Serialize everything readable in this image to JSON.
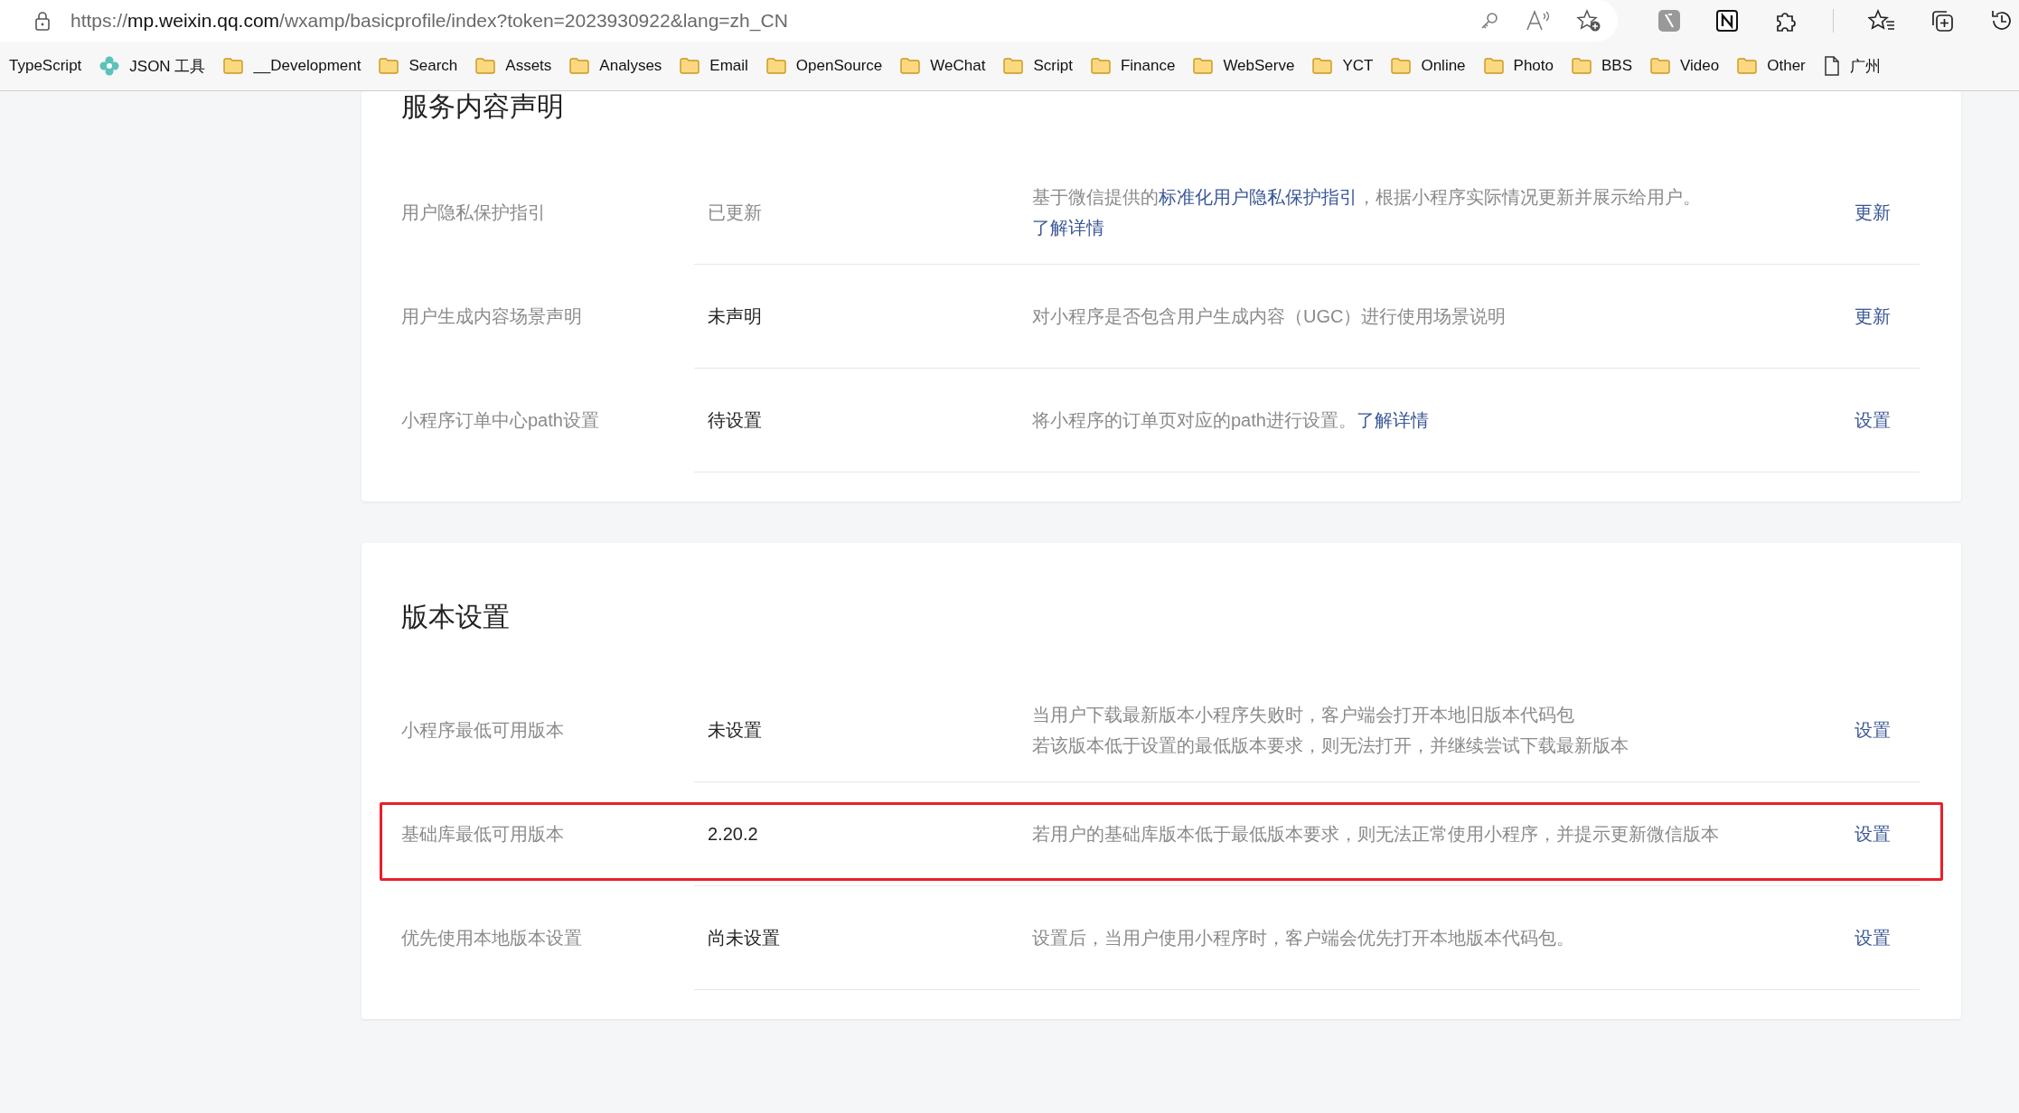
{
  "browser": {
    "url": {
      "scheme": "https://",
      "host": "mp.weixin.qq.com",
      "path": "/wxamp/basicprofile/index?token=2023930922&lang=zh_CN"
    },
    "bookmarks": [
      {
        "kind": "plain",
        "label": "TypeScript"
      },
      {
        "kind": "app",
        "label": "JSON 工具"
      },
      {
        "kind": "folder",
        "label": "__Development"
      },
      {
        "kind": "folder",
        "label": "Search"
      },
      {
        "kind": "folder",
        "label": "Assets"
      },
      {
        "kind": "folder",
        "label": "Analyses"
      },
      {
        "kind": "folder",
        "label": "Email"
      },
      {
        "kind": "folder",
        "label": "OpenSource"
      },
      {
        "kind": "folder",
        "label": "WeChat"
      },
      {
        "kind": "folder",
        "label": "Script"
      },
      {
        "kind": "folder",
        "label": "Finance"
      },
      {
        "kind": "folder",
        "label": "WebServe"
      },
      {
        "kind": "folder",
        "label": "YCT"
      },
      {
        "kind": "folder",
        "label": "Online"
      },
      {
        "kind": "folder",
        "label": "Photo"
      },
      {
        "kind": "folder",
        "label": "BBS"
      },
      {
        "kind": "folder",
        "label": "Video"
      },
      {
        "kind": "folder",
        "label": "Other"
      },
      {
        "kind": "page",
        "label": "广州"
      }
    ]
  },
  "sections": [
    {
      "title": "服务内容声明",
      "rows": [
        {
          "label": "用户隐私保护指引",
          "value": "已更新",
          "muted": true,
          "highlighted": false,
          "description": [
            {
              "kind": "text",
              "text": "基于微信提供的"
            },
            {
              "kind": "link",
              "text": "标准化用户隐私保护指引"
            },
            {
              "kind": "text",
              "text": "，根据小程序实际情况更新并展示给用户。"
            },
            {
              "kind": "link",
              "text": "了解详情"
            }
          ],
          "action": "更新"
        },
        {
          "label": "用户生成内容场景声明",
          "value": "未声明",
          "muted": false,
          "highlighted": false,
          "description": [
            {
              "kind": "text",
              "text": "对小程序是否包含用户生成内容（UGC）进行使用场景说明"
            }
          ],
          "action": "更新"
        },
        {
          "label": "小程序订单中心path设置",
          "value": "待设置",
          "muted": false,
          "highlighted": false,
          "description": [
            {
              "kind": "text",
              "text": "将小程序的订单页对应的path进行设置。"
            },
            {
              "kind": "link",
              "text": "了解详情"
            }
          ],
          "action": "设置"
        }
      ]
    },
    {
      "title": "版本设置",
      "rows": [
        {
          "label": "小程序最低可用版本",
          "value": "未设置",
          "muted": false,
          "highlighted": false,
          "description": [
            {
              "kind": "text",
              "text": "当用户下载最新版本小程序失败时，客户端会打开本地旧版本代码包"
            },
            {
              "kind": "break"
            },
            {
              "kind": "text",
              "text": "若该版本低于设置的最低版本要求，则无法打开，并继续尝试下载最新版本"
            }
          ],
          "action": "设置"
        },
        {
          "label": "基础库最低可用版本",
          "value": "2.20.2",
          "muted": false,
          "highlighted": true,
          "description": [
            {
              "kind": "text",
              "text": "若用户的基础库版本低于最低版本要求，则无法正常使用小程序，并提示更新微信版本"
            }
          ],
          "action": "设置"
        },
        {
          "label": "优先使用本地版本设置",
          "value": "尚未设置",
          "muted": false,
          "highlighted": false,
          "description": [
            {
              "kind": "text",
              "text": "设置后，当用户使用小程序时，客户端会优先打开本地版本代码包。"
            }
          ],
          "action": "设置"
        }
      ]
    }
  ]
}
